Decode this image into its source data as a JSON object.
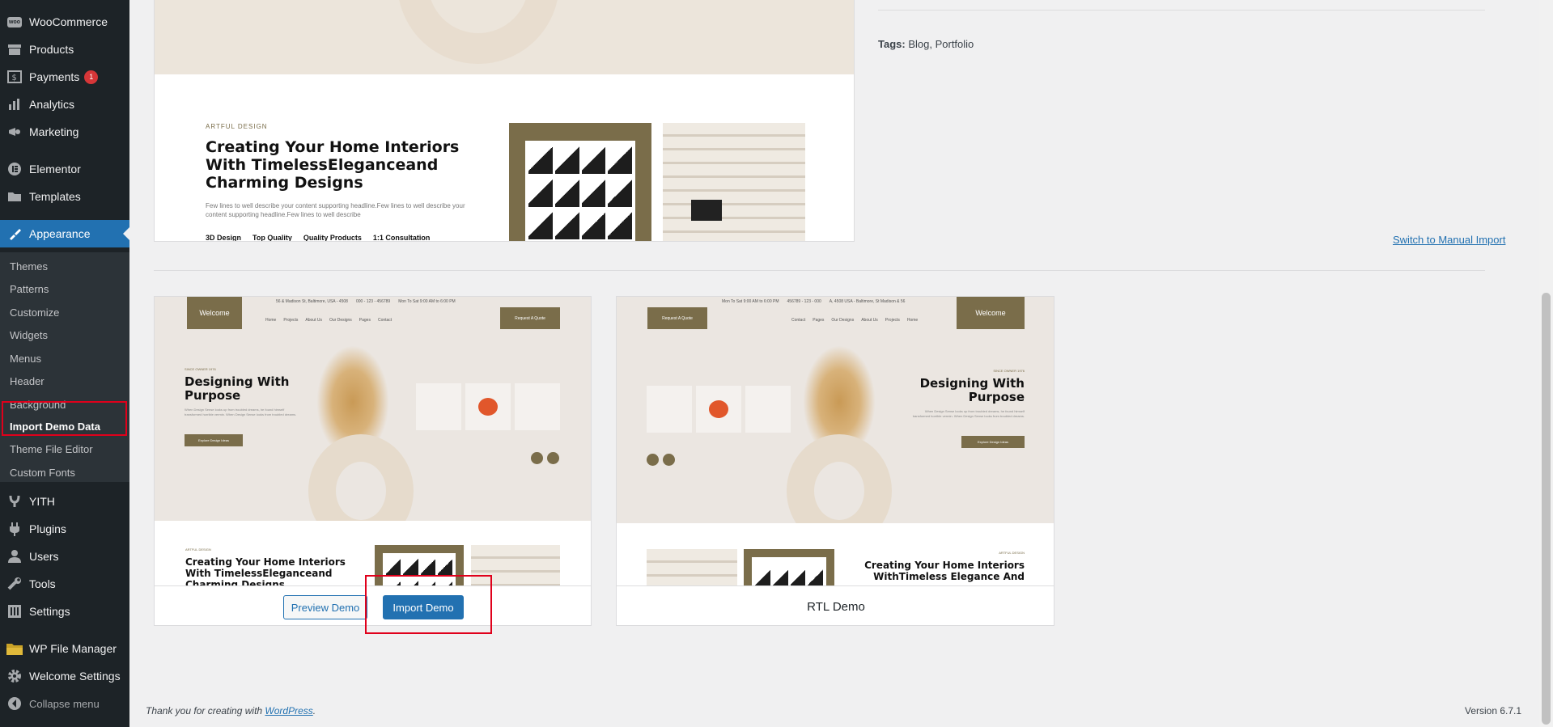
{
  "sidebar": {
    "items": [
      {
        "label": "WooCommerce",
        "icon": "woo-icon"
      },
      {
        "label": "Products",
        "icon": "archive-icon"
      },
      {
        "label": "Payments",
        "icon": "dollar-icon",
        "badge": "1"
      },
      {
        "label": "Analytics",
        "icon": "chart-bar-icon"
      },
      {
        "label": "Marketing",
        "icon": "megaphone-icon"
      },
      {
        "label": "Elementor",
        "icon": "elementor-icon"
      },
      {
        "label": "Templates",
        "icon": "folder-icon"
      },
      {
        "label": "Appearance",
        "icon": "brush-icon"
      },
      {
        "label": "YITH",
        "icon": "yith-icon"
      },
      {
        "label": "Plugins",
        "icon": "plug-icon"
      },
      {
        "label": "Users",
        "icon": "user-icon"
      },
      {
        "label": "Tools",
        "icon": "wrench-icon"
      },
      {
        "label": "Settings",
        "icon": "settings-icon"
      },
      {
        "label": "WP File Manager",
        "icon": "folder-icon"
      },
      {
        "label": "Welcome Settings",
        "icon": "gear-icon"
      }
    ],
    "submenu": [
      "Themes",
      "Patterns",
      "Customize",
      "Widgets",
      "Menus",
      "Header",
      "Background",
      "Import Demo Data",
      "Theme File Editor",
      "Custom Fonts"
    ],
    "collapse": "Collapse menu"
  },
  "top": {
    "tags_label": "Tags:",
    "tags_value": "Blog, Portfolio",
    "switch_link": "Switch to Manual Import"
  },
  "hero": {
    "kicker": "ARTFUL DESIGN",
    "heading": "Creating Your Home Interiors With TimelessEleganceand Charming Designs",
    "desc": "Few lines to well describe your content supporting headline.Few lines to well describe your content supporting headline.Few lines to well describe",
    "features": [
      "3D Design",
      "Top Quality",
      "Quality Products",
      "1:1 Consultation"
    ]
  },
  "demo1": {
    "logo": "Welcome",
    "address": "56 & Madison St, Baltimore, USA - 4508",
    "phone": "000 - 123 - 456789",
    "hours": "Mon To Sat 9:00 AM to 6:00 PM",
    "nav": [
      "Home",
      "Projects",
      "About Us",
      "Our Designs",
      "Pages",
      "Contact"
    ],
    "cta": "Request A Quote",
    "kicker": "SINCE OWNER 1976",
    "heading": "Designing With Purpose",
    "desc": "When Design Sense looks up from troubled dreams, he found himself transformed horrible vermin. When Design Sense looks from troubled dreams.",
    "explore": "Explore Design Ideas",
    "sub_kicker": "ARTFUL DESIGN",
    "sub_heading": "Creating Your Home Interiors With TimelessEleganceand Charming Designs",
    "preview_btn": "Preview Demo",
    "import_btn": "Import Demo"
  },
  "demo2": {
    "logo": "Welcome",
    "hours": "Mon To Sat 9:00 AM to 6:00 PM",
    "phone": "456789 - 123 - 000",
    "address": "A, 4508 USA - Baltimore, St Madison & 56",
    "nav": [
      "Contact",
      "Pages",
      "Our Designs",
      "About Us",
      "Projects",
      "Home"
    ],
    "cta": "Request A Quote",
    "kicker": "SINCE OWNER 1976",
    "heading": "Designing With Purpose",
    "desc": "When Design Sense looks up from troubled dreams, he found himself transformed horrible vermin. When Design Sense looks from troubled dreams.",
    "explore": "Explore Design Ideas",
    "sub_kicker": "ARTFUL DESIGN",
    "sub_heading": "Creating Your Home Interiors WithTimeless Elegance And",
    "title": "RTL Demo"
  },
  "footer": {
    "thanks": "Thank you for creating with",
    "link": "WordPress",
    "version": "Version 6.7.1"
  }
}
